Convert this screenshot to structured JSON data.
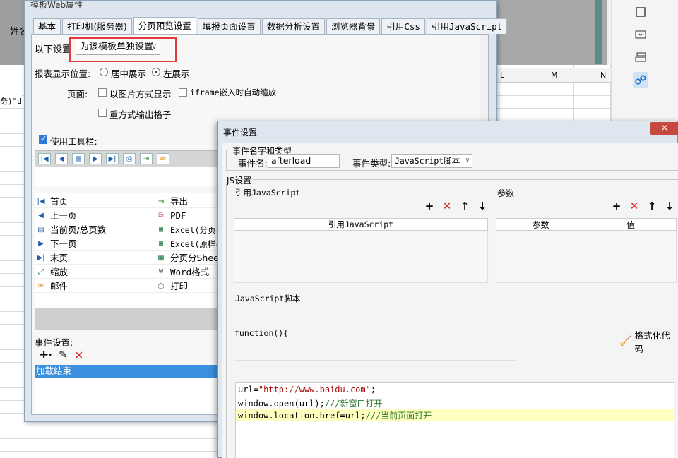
{
  "background": {
    "name_label": "姓名",
    "cell_text": "务)\"d",
    "columns": [
      "L",
      "M",
      "N"
    ]
  },
  "web_dialog": {
    "title": "模板Web属性",
    "tabs": [
      "基本",
      "打印机(服务器)",
      "分页预览设置",
      "填报页面设置",
      "数据分析设置",
      "浏览器背景",
      "引用Css",
      "引用JavaScript"
    ],
    "active_tab": "分页预览设置",
    "setting_label": "以下设置",
    "setting_value": "为该模板单独设置",
    "position_label": "报表显示位置:",
    "position_options": [
      "居中展示",
      "左展示"
    ],
    "position_selected": "左展示",
    "page_label": "页面:",
    "page_options": [
      "以图片方式显示",
      "iframe嵌入时自动缩放",
      "重方式输出格子"
    ],
    "toolbar_label": "使用工具栏:",
    "toolbar_buttons": [
      {
        "label": "首页",
        "icon": "first-page-icon"
      },
      {
        "label": "导出",
        "icon": "export-icon"
      },
      {
        "label": "上一页",
        "icon": "prev-page-icon"
      },
      {
        "label": "PDF",
        "icon": "pdf-icon"
      },
      {
        "label": "当前页/总页数",
        "icon": "page-count-icon"
      },
      {
        "label": "Excel(分页导",
        "icon": "excel-icon"
      },
      {
        "label": "下一页",
        "icon": "next-page-icon"
      },
      {
        "label": "Excel(原样导",
        "icon": "excel-icon"
      },
      {
        "label": "末页",
        "icon": "last-page-icon"
      },
      {
        "label": "分页分Sheet",
        "icon": "excel-icon"
      },
      {
        "label": "缩放",
        "icon": "zoom-icon"
      },
      {
        "label": "Word格式",
        "icon": "word-icon"
      },
      {
        "label": "邮件",
        "icon": "mail-icon"
      },
      {
        "label": "打印",
        "icon": "print-icon"
      }
    ],
    "event_label": "事件设置:",
    "events": [
      "加载结束"
    ]
  },
  "event_dialog": {
    "title": "事件设置",
    "close_label": "×",
    "name_section": "事件名字和类型",
    "event_name_label": "事件名:",
    "event_name_value": "afterload",
    "event_type_label": "事件类型:",
    "event_type_value": "JavaScript脚本",
    "js_section": "JS设置",
    "ref_js_label": "引用JavaScript",
    "ref_js_column": "引用JavaScript",
    "params_label": "参数",
    "params_columns": [
      "参数",
      "值"
    ],
    "script_label": "JavaScript脚本",
    "function_header": "function(){",
    "format_label": "格式化代码",
    "code": [
      {
        "plain": "url=",
        "str": "\"http://www.baidu.com\"",
        "tail": ";",
        "comment": ""
      },
      {
        "plain": "window.open(url);",
        "str": "",
        "tail": "",
        "comment": "///新窗口打开"
      },
      {
        "plain": "window.location.href=url;",
        "str": "",
        "tail": "",
        "comment": "///当前页面打开"
      }
    ]
  },
  "colors": {
    "accent": "#3b8fdf",
    "highlight_border": "#e23b3b",
    "close_red": "#c7483e"
  }
}
